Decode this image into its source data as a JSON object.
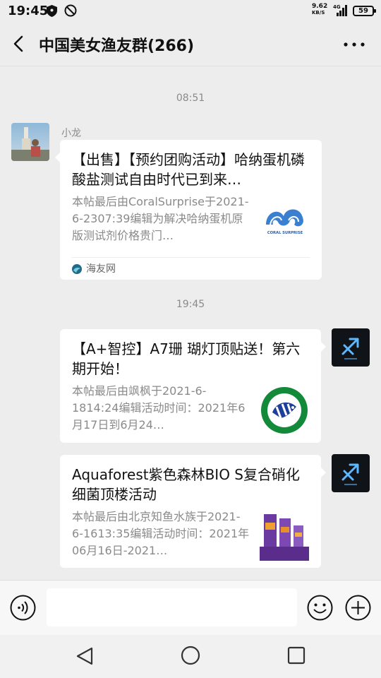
{
  "status_bar": {
    "time": "19:45",
    "net_speed_value": "9.62",
    "net_speed_unit": "KB/S",
    "network_type": "4G",
    "battery": "59"
  },
  "header": {
    "title": "中国美女渔友群(266)"
  },
  "chat": {
    "timestamps": [
      "08:51",
      "19:45"
    ],
    "messages": [
      {
        "sender": "小龙",
        "title": "【出售】【预约团购活动】哈纳蛋机磷酸盐测试自由时代已到来…",
        "desc": "本帖最后由CoralSurprise于2021-6-2307:39编辑为解决哈纳蛋机原版测试剂价格贵门…",
        "thumb_label": "CORAL SURPRISE",
        "source": "海友网"
      },
      {
        "title": "【A+智控】A7珊 瑚灯顶贴送！第六期开始！",
        "desc": "本帖最后由飒枫于2021-6-1814:24编辑活动时间：2021年6月17日到6月24…"
      },
      {
        "title": "Aquaforest紫色森林BIO S复合硝化细菌顶楼活动",
        "desc": "本帖最后由北京知鱼水族于2021-6-1613:35编辑活动时间：2021年06月16日-2021…"
      }
    ]
  },
  "input_bar": {
    "placeholder": ""
  },
  "colors": {
    "background": "#ededed",
    "bubble": "#ffffff",
    "meta_text": "#8a8a8a"
  }
}
